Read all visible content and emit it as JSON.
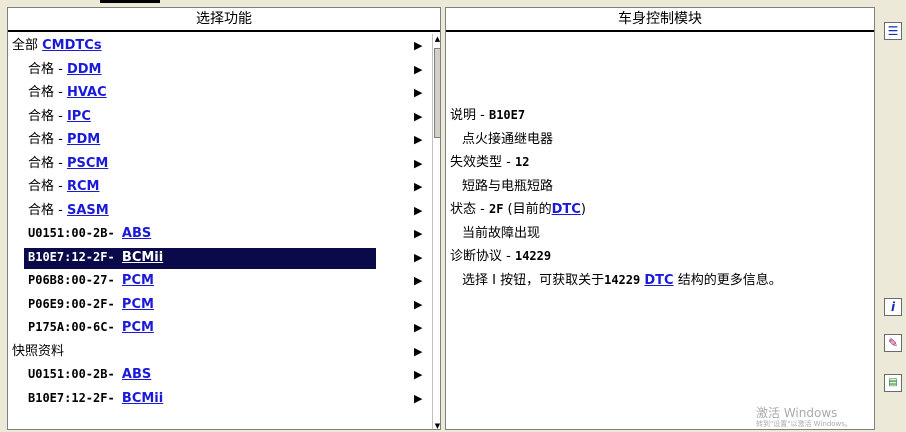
{
  "left_panel": {
    "title": "选择功能",
    "rows": [
      {
        "prefix": "全部 ",
        "link": "CMDTCs",
        "code": "",
        "indent": false,
        "selected": false
      },
      {
        "prefix": "合格 - ",
        "link": "DDM",
        "code": "",
        "indent": true,
        "selected": false
      },
      {
        "prefix": "合格 - ",
        "link": "HVAC",
        "code": "",
        "indent": true,
        "selected": false
      },
      {
        "prefix": "合格 - ",
        "link": "IPC",
        "code": "",
        "indent": true,
        "selected": false
      },
      {
        "prefix": "合格 - ",
        "link": "PDM",
        "code": "",
        "indent": true,
        "selected": false
      },
      {
        "prefix": "合格 - ",
        "link": "PSCM",
        "code": "",
        "indent": true,
        "selected": false
      },
      {
        "prefix": "合格 - ",
        "link": "RCM",
        "code": "",
        "indent": true,
        "selected": false
      },
      {
        "prefix": "合格 - ",
        "link": "SASM",
        "code": "",
        "indent": true,
        "selected": false
      },
      {
        "prefix": "",
        "code": "U0151:00-2B- ",
        "link": "ABS",
        "indent": true,
        "selected": false
      },
      {
        "prefix": "",
        "code": "B10E7:12-2F- ",
        "link": "BCMii",
        "indent": true,
        "selected": true
      },
      {
        "prefix": "",
        "code": "P06B8:00-27- ",
        "link": "PCM",
        "indent": true,
        "selected": false
      },
      {
        "prefix": "",
        "code": "P06E9:00-2F- ",
        "link": "PCM",
        "indent": true,
        "selected": false
      },
      {
        "prefix": "",
        "code": "P175A:00-6C- ",
        "link": "PCM",
        "indent": true,
        "selected": false
      },
      {
        "prefix": "快照资料",
        "link": "",
        "code": "",
        "indent": false,
        "selected": false
      },
      {
        "prefix": "",
        "code": "U0151:00-2B- ",
        "link": "ABS",
        "indent": true,
        "selected": false
      },
      {
        "prefix": "",
        "code": "B10E7:12-2F- ",
        "link": "BCMii",
        "indent": true,
        "selected": false
      }
    ],
    "arrow_glyph": "▶"
  },
  "right_panel": {
    "title": "车身控制模块",
    "lines": [
      {
        "a": "说明 - ",
        "b": "B10E7",
        "link": "",
        "c": "",
        "indent": false
      },
      {
        "a": "点火接通继电器",
        "b": "",
        "link": "",
        "c": "",
        "indent": true
      },
      {
        "a": "失效类型 - ",
        "b": "12",
        "link": "",
        "c": "",
        "indent": false
      },
      {
        "a": "短路与电瓶短路",
        "b": "",
        "link": "",
        "c": "",
        "indent": true
      },
      {
        "a": "状态 - ",
        "b": "2F",
        "link": "DTC",
        "c": ")",
        "pre_link": " (目前的",
        "indent": false
      },
      {
        "a": "当前故障出现",
        "b": "",
        "link": "",
        "c": "",
        "indent": true
      },
      {
        "a": "诊断协议 - ",
        "b": "14229",
        "link": "",
        "c": "",
        "indent": false
      },
      {
        "a": "选择 I 按钮，可获取关于",
        "b": "14229",
        "link": "DTC",
        "c": " 结构的更多信息。",
        "pre_link": " ",
        "indent": true
      }
    ]
  },
  "watermark": {
    "line1": "激活 Windows",
    "line2": "转到\"设置\"以激活 Windows。"
  },
  "toolbar": {
    "items": [
      {
        "name": "list-icon",
        "glyph": "☰"
      },
      {
        "name": "info-icon",
        "glyph": "i"
      },
      {
        "name": "edit-note-icon",
        "glyph": "✎"
      },
      {
        "name": "document-icon",
        "glyph": "▤"
      }
    ]
  }
}
